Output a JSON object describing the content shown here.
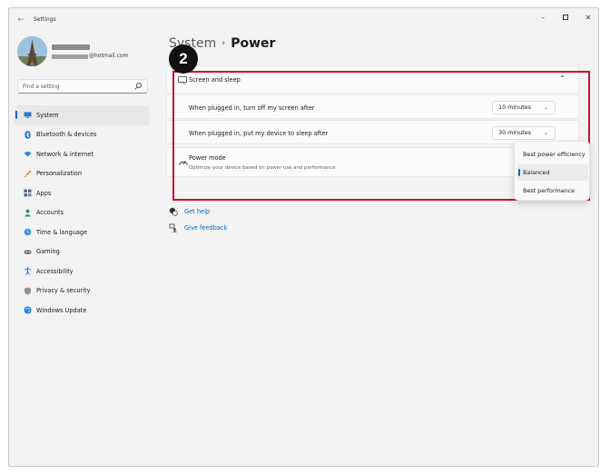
{
  "window": {
    "title": "Settings",
    "controls": {
      "minimize": "–",
      "close": "✕"
    }
  },
  "user": {
    "email": "@hotmail.com"
  },
  "search": {
    "placeholder": "Find a setting"
  },
  "sidebar": {
    "items": [
      {
        "label": "System",
        "icon": "monitor-icon",
        "active": true
      },
      {
        "label": "Bluetooth & devices",
        "icon": "bluetooth-icon"
      },
      {
        "label": "Network & internet",
        "icon": "wifi-icon"
      },
      {
        "label": "Personalization",
        "icon": "brush-icon"
      },
      {
        "label": "Apps",
        "icon": "apps-icon"
      },
      {
        "label": "Accounts",
        "icon": "person-icon"
      },
      {
        "label": "Time & language",
        "icon": "globe-clock-icon"
      },
      {
        "label": "Gaming",
        "icon": "gamepad-icon"
      },
      {
        "label": "Accessibility",
        "icon": "accessibility-icon"
      },
      {
        "label": "Privacy & security",
        "icon": "shield-icon"
      },
      {
        "label": "Windows Update",
        "icon": "update-icon"
      }
    ]
  },
  "breadcrumb": {
    "parent": "System",
    "separator": "›",
    "current": "Power"
  },
  "step_badge": "2",
  "screen_sleep": {
    "title": "Screen and sleep",
    "rows": [
      {
        "label": "When plugged in, turn off my screen after",
        "value": "10 minutes"
      },
      {
        "label": "When plugged in, put my device to sleep after",
        "value": "30 minutes"
      }
    ]
  },
  "power_mode": {
    "title": "Power mode",
    "description": "Optimize your device based on power use and performance",
    "options": [
      "Best power efficiency",
      "Balanced",
      "Best performance"
    ],
    "selected": "Balanced"
  },
  "links": {
    "help": "Get help",
    "feedback": "Give feedback"
  },
  "colors": {
    "accent": "#0067c0",
    "highlight": "#c8102e"
  }
}
